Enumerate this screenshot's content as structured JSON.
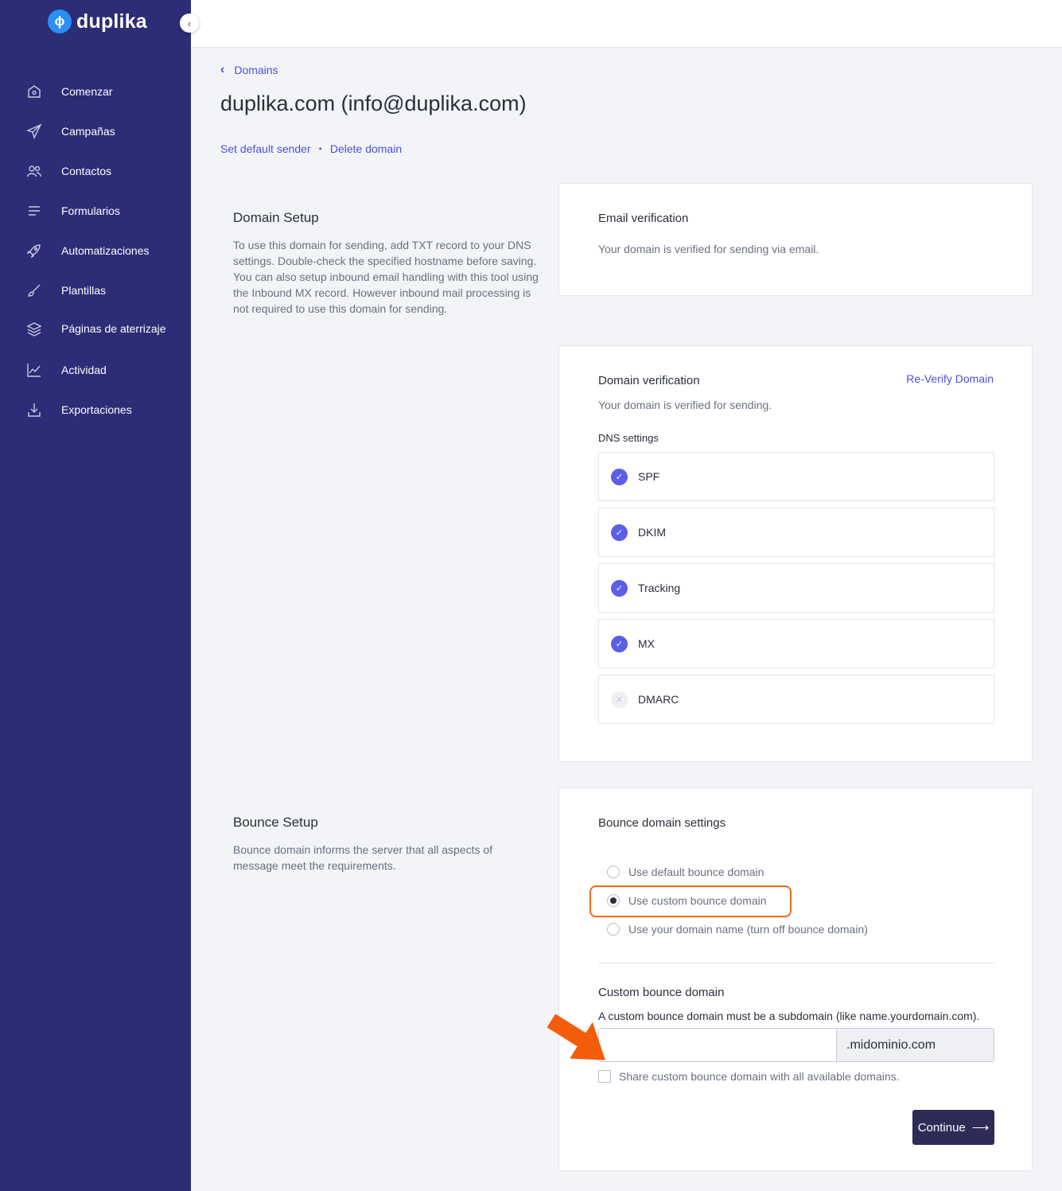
{
  "brand": {
    "name": "duplika",
    "logo_glyph": "ɸ"
  },
  "sidebar": {
    "items": [
      {
        "label": "Comenzar",
        "icon": "home-icon"
      },
      {
        "label": "Campañas",
        "icon": "paper-plane-icon"
      },
      {
        "label": "Contactos",
        "icon": "users-icon"
      },
      {
        "label": "Formularios",
        "icon": "list-icon"
      },
      {
        "label": "Automatizaciones",
        "icon": "rocket-icon"
      },
      {
        "label": "Plantillas",
        "icon": "brush-icon"
      },
      {
        "label": "Páginas de aterrizaje",
        "icon": "layers-icon"
      },
      {
        "label": "Actividad",
        "icon": "chart-icon"
      },
      {
        "label": "Exportaciones",
        "icon": "download-icon"
      }
    ]
  },
  "breadcrumb": {
    "back_label": "Domains"
  },
  "page": {
    "title": "duplika.com (info@duplika.com)",
    "set_default_sender": "Set default sender",
    "separator": "•",
    "delete_domain": "Delete domain"
  },
  "domain_setup": {
    "title": "Domain Setup",
    "description_1": "To use this domain for sending, add TXT record to your DNS settings. Double-check the specified hostname before saving.",
    "description_2": "You can also setup inbound email handling with this tool using the Inbound MX record. However inbound mail processing is not required to use this domain for sending."
  },
  "email_verification": {
    "title": "Email verification",
    "text": "Your domain is verified for sending via email."
  },
  "domain_verification": {
    "title": "Domain verification",
    "reverify_label": "Re-Verify Domain",
    "text": "Your domain is verified for sending.",
    "dns_label": "DNS settings",
    "records": [
      {
        "name": "SPF",
        "verified": true
      },
      {
        "name": "DKIM",
        "verified": true
      },
      {
        "name": "Tracking",
        "verified": true
      },
      {
        "name": "MX",
        "verified": true
      },
      {
        "name": "DMARC",
        "verified": false
      }
    ]
  },
  "bounce_setup": {
    "title": "Bounce Setup",
    "description": "Bounce domain informs the server that all aspects of message meet the requirements."
  },
  "bounce_settings": {
    "title": "Bounce domain settings",
    "options": [
      {
        "label": "Use default bounce domain",
        "selected": false
      },
      {
        "label": "Use custom bounce domain",
        "selected": true
      },
      {
        "label": "Use your domain name (turn off bounce domain)",
        "selected": false
      }
    ],
    "custom_title": "Custom bounce domain",
    "custom_help": "A custom bounce domain must be a subdomain (like name.yourdomain.com).",
    "input_value": "",
    "input_suffix": ".midominio.com",
    "share_label": "Share custom bounce domain with all available domains.",
    "share_checked": false,
    "continue_label": "Continue"
  },
  "colors": {
    "sidebar": "#2c2c77",
    "link": "#4b52d6",
    "check": "#5b5ee8",
    "highlight": "#ec6a1f",
    "button": "#2c2c56"
  }
}
